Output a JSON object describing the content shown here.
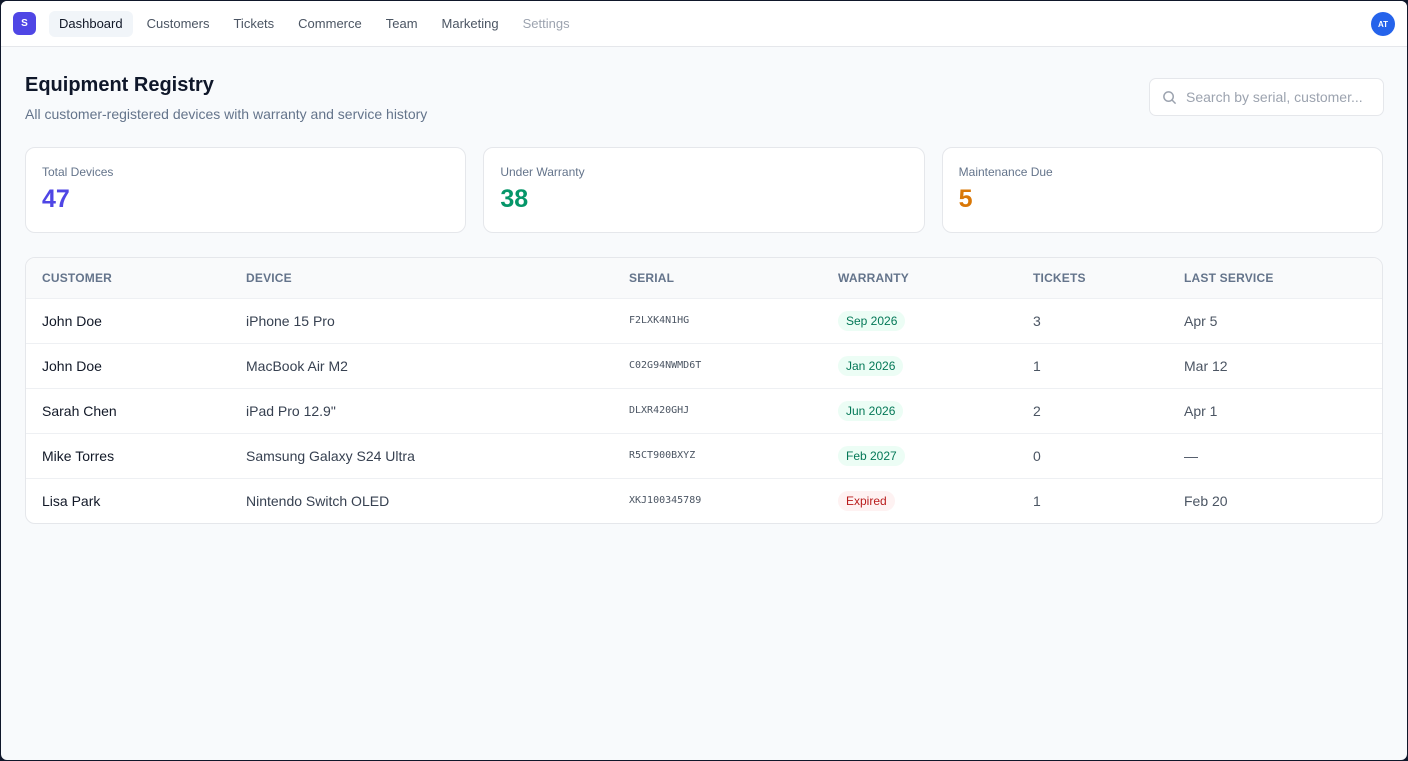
{
  "app": {
    "logo_letter": "S",
    "avatar_initials": "AT"
  },
  "nav": {
    "items": [
      {
        "label": "Dashboard",
        "active": true
      },
      {
        "label": "Customers"
      },
      {
        "label": "Tickets"
      },
      {
        "label": "Commerce"
      },
      {
        "label": "Team"
      },
      {
        "label": "Marketing"
      },
      {
        "label": "Settings",
        "muted": true
      }
    ]
  },
  "page": {
    "title": "Equipment Registry",
    "subtitle": "All customer-registered devices with warranty and service history"
  },
  "search": {
    "placeholder": "Search by serial, customer...",
    "value": "",
    "icon": "search-icon"
  },
  "stats": [
    {
      "label": "Total Devices",
      "value": "47",
      "color": "#4f46e5"
    },
    {
      "label": "Under Warranty",
      "value": "38",
      "color": "#059669"
    },
    {
      "label": "Maintenance Due",
      "value": "5",
      "color": "#d97706"
    }
  ],
  "table": {
    "columns": [
      "CUSTOMER",
      "DEVICE",
      "SERIAL",
      "WARRANTY",
      "TICKETS",
      "LAST SERVICE"
    ],
    "rows": [
      {
        "customer": "John Doe",
        "device": "iPhone 15 Pro",
        "serial": "F2LXK4N1HG",
        "warranty": "Sep 2026",
        "status": "ok",
        "tickets": "3",
        "last_service": "Apr 5"
      },
      {
        "customer": "John Doe",
        "device": "MacBook Air M2",
        "serial": "C02G94NWMD6T",
        "warranty": "Jan 2026",
        "status": "ok",
        "tickets": "1",
        "last_service": "Mar 12"
      },
      {
        "customer": "Sarah Chen",
        "device": "iPad Pro 12.9\"",
        "serial": "DLXR420GHJ",
        "warranty": "Jun 2026",
        "status": "ok",
        "tickets": "2",
        "last_service": "Apr 1"
      },
      {
        "customer": "Mike Torres",
        "device": "Samsung Galaxy S24 Ultra",
        "serial": "R5CT900BXYZ",
        "warranty": "Feb 2027",
        "status": "ok",
        "tickets": "0",
        "last_service": "—"
      },
      {
        "customer": "Lisa Park",
        "device": "Nintendo Switch OLED",
        "serial": "XKJ100345789",
        "warranty": "Expired",
        "status": "expired",
        "tickets": "1",
        "last_service": "Feb 20"
      }
    ]
  }
}
